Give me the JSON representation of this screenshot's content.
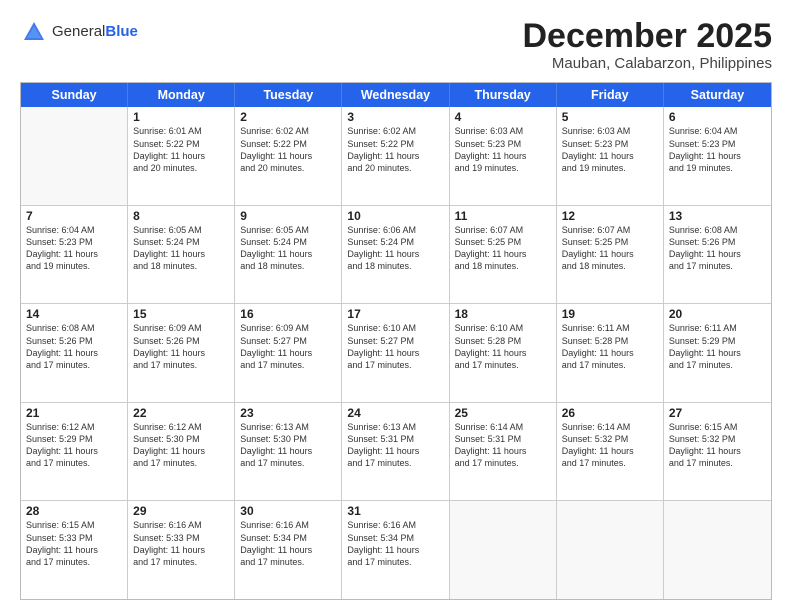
{
  "logo": {
    "general": "General",
    "blue": "Blue"
  },
  "title": "December 2025",
  "location": "Mauban, Calabarzon, Philippines",
  "header_days": [
    "Sunday",
    "Monday",
    "Tuesday",
    "Wednesday",
    "Thursday",
    "Friday",
    "Saturday"
  ],
  "weeks": [
    [
      {
        "day": "",
        "info": ""
      },
      {
        "day": "1",
        "info": "Sunrise: 6:01 AM\nSunset: 5:22 PM\nDaylight: 11 hours\nand 20 minutes."
      },
      {
        "day": "2",
        "info": "Sunrise: 6:02 AM\nSunset: 5:22 PM\nDaylight: 11 hours\nand 20 minutes."
      },
      {
        "day": "3",
        "info": "Sunrise: 6:02 AM\nSunset: 5:22 PM\nDaylight: 11 hours\nand 20 minutes."
      },
      {
        "day": "4",
        "info": "Sunrise: 6:03 AM\nSunset: 5:23 PM\nDaylight: 11 hours\nand 19 minutes."
      },
      {
        "day": "5",
        "info": "Sunrise: 6:03 AM\nSunset: 5:23 PM\nDaylight: 11 hours\nand 19 minutes."
      },
      {
        "day": "6",
        "info": "Sunrise: 6:04 AM\nSunset: 5:23 PM\nDaylight: 11 hours\nand 19 minutes."
      }
    ],
    [
      {
        "day": "7",
        "info": "Sunrise: 6:04 AM\nSunset: 5:23 PM\nDaylight: 11 hours\nand 19 minutes."
      },
      {
        "day": "8",
        "info": "Sunrise: 6:05 AM\nSunset: 5:24 PM\nDaylight: 11 hours\nand 18 minutes."
      },
      {
        "day": "9",
        "info": "Sunrise: 6:05 AM\nSunset: 5:24 PM\nDaylight: 11 hours\nand 18 minutes."
      },
      {
        "day": "10",
        "info": "Sunrise: 6:06 AM\nSunset: 5:24 PM\nDaylight: 11 hours\nand 18 minutes."
      },
      {
        "day": "11",
        "info": "Sunrise: 6:07 AM\nSunset: 5:25 PM\nDaylight: 11 hours\nand 18 minutes."
      },
      {
        "day": "12",
        "info": "Sunrise: 6:07 AM\nSunset: 5:25 PM\nDaylight: 11 hours\nand 18 minutes."
      },
      {
        "day": "13",
        "info": "Sunrise: 6:08 AM\nSunset: 5:26 PM\nDaylight: 11 hours\nand 17 minutes."
      }
    ],
    [
      {
        "day": "14",
        "info": "Sunrise: 6:08 AM\nSunset: 5:26 PM\nDaylight: 11 hours\nand 17 minutes."
      },
      {
        "day": "15",
        "info": "Sunrise: 6:09 AM\nSunset: 5:26 PM\nDaylight: 11 hours\nand 17 minutes."
      },
      {
        "day": "16",
        "info": "Sunrise: 6:09 AM\nSunset: 5:27 PM\nDaylight: 11 hours\nand 17 minutes."
      },
      {
        "day": "17",
        "info": "Sunrise: 6:10 AM\nSunset: 5:27 PM\nDaylight: 11 hours\nand 17 minutes."
      },
      {
        "day": "18",
        "info": "Sunrise: 6:10 AM\nSunset: 5:28 PM\nDaylight: 11 hours\nand 17 minutes."
      },
      {
        "day": "19",
        "info": "Sunrise: 6:11 AM\nSunset: 5:28 PM\nDaylight: 11 hours\nand 17 minutes."
      },
      {
        "day": "20",
        "info": "Sunrise: 6:11 AM\nSunset: 5:29 PM\nDaylight: 11 hours\nand 17 minutes."
      }
    ],
    [
      {
        "day": "21",
        "info": "Sunrise: 6:12 AM\nSunset: 5:29 PM\nDaylight: 11 hours\nand 17 minutes."
      },
      {
        "day": "22",
        "info": "Sunrise: 6:12 AM\nSunset: 5:30 PM\nDaylight: 11 hours\nand 17 minutes."
      },
      {
        "day": "23",
        "info": "Sunrise: 6:13 AM\nSunset: 5:30 PM\nDaylight: 11 hours\nand 17 minutes."
      },
      {
        "day": "24",
        "info": "Sunrise: 6:13 AM\nSunset: 5:31 PM\nDaylight: 11 hours\nand 17 minutes."
      },
      {
        "day": "25",
        "info": "Sunrise: 6:14 AM\nSunset: 5:31 PM\nDaylight: 11 hours\nand 17 minutes."
      },
      {
        "day": "26",
        "info": "Sunrise: 6:14 AM\nSunset: 5:32 PM\nDaylight: 11 hours\nand 17 minutes."
      },
      {
        "day": "27",
        "info": "Sunrise: 6:15 AM\nSunset: 5:32 PM\nDaylight: 11 hours\nand 17 minutes."
      }
    ],
    [
      {
        "day": "28",
        "info": "Sunrise: 6:15 AM\nSunset: 5:33 PM\nDaylight: 11 hours\nand 17 minutes."
      },
      {
        "day": "29",
        "info": "Sunrise: 6:16 AM\nSunset: 5:33 PM\nDaylight: 11 hours\nand 17 minutes."
      },
      {
        "day": "30",
        "info": "Sunrise: 6:16 AM\nSunset: 5:34 PM\nDaylight: 11 hours\nand 17 minutes."
      },
      {
        "day": "31",
        "info": "Sunrise: 6:16 AM\nSunset: 5:34 PM\nDaylight: 11 hours\nand 17 minutes."
      },
      {
        "day": "",
        "info": ""
      },
      {
        "day": "",
        "info": ""
      },
      {
        "day": "",
        "info": ""
      }
    ]
  ]
}
